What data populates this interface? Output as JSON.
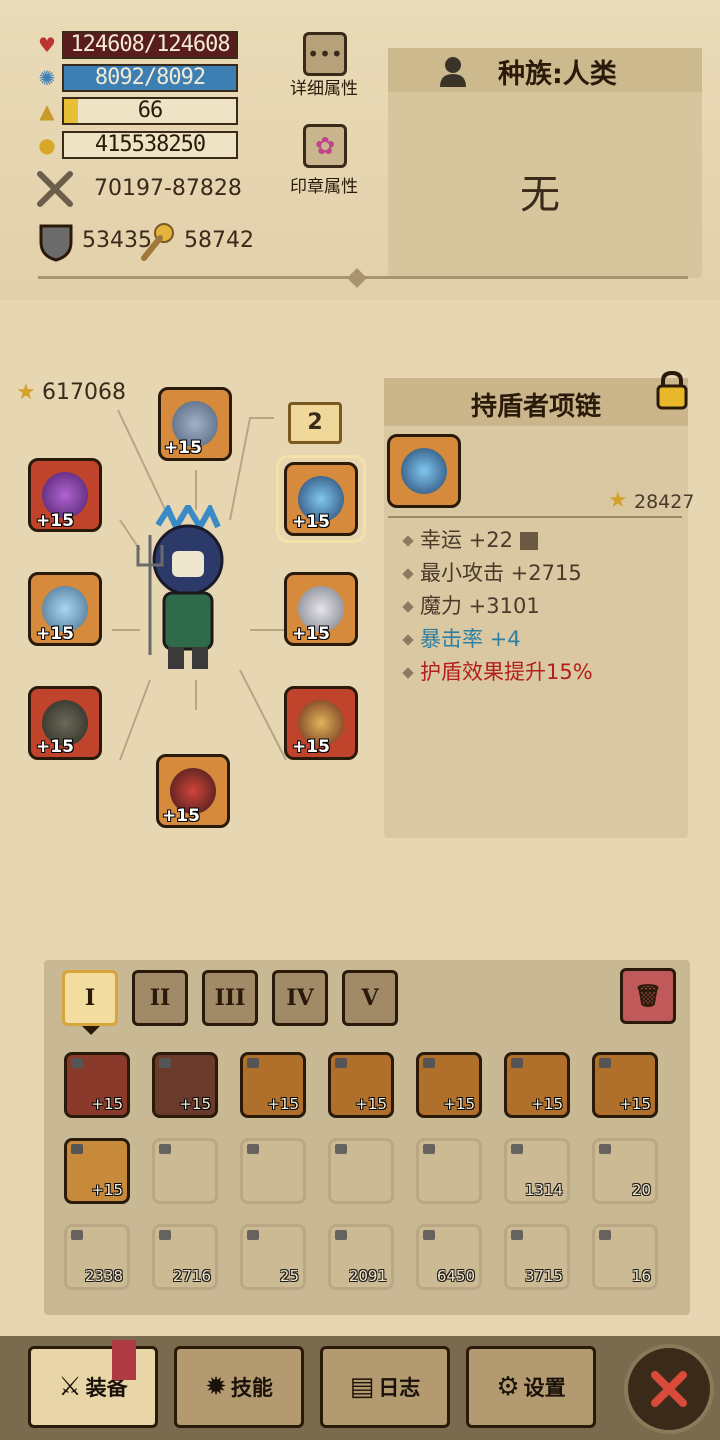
{
  "stats": {
    "hp": "124608/124608",
    "mp": "8092/8092",
    "level": "66",
    "level_progress": 0.08,
    "gold": "415538250",
    "attack": "70197-87828",
    "defense": "53435",
    "magic": "58742"
  },
  "top_buttons": {
    "detail_label": "详细属性",
    "seal_label": "印章属性"
  },
  "race": {
    "label": "种族:人类",
    "value": "无"
  },
  "equipment": {
    "score": "617068",
    "page_badge": "2",
    "plus": "+15"
  },
  "item": {
    "name": "持盾者项链",
    "score": "28427",
    "plus": "+15",
    "attrs": [
      {
        "text": "幸运 +22",
        "color": "#4a3a2a"
      },
      {
        "text": "最小攻击 +2715",
        "color": "#4a3a2a"
      },
      {
        "text": "魔力 +3101",
        "color": "#4a3a2a"
      },
      {
        "text": "暴击率 +4",
        "color": "#2f7fa3"
      },
      {
        "text": "护盾效果提升15%",
        "color": "#b41e1e"
      }
    ]
  },
  "inventory": {
    "tabs": [
      "I",
      "II",
      "III",
      "IV",
      "V"
    ],
    "row1": [
      "+15",
      "+15",
      "+15",
      "+15",
      "+15",
      "+15",
      "+15"
    ],
    "row2_first": "+15",
    "row2_counts": [
      "",
      "",
      "",
      "",
      "1314",
      "20"
    ],
    "row3_counts": [
      "2338",
      "2716",
      "25",
      "2091",
      "6450",
      "3715",
      "16"
    ]
  },
  "nav": {
    "equip": "装备",
    "skill": "技能",
    "log": "日志",
    "settings": "设置"
  },
  "colors": {
    "hp_bar": "#5a1d1d",
    "mp_bar": "#3d7fb3",
    "xp_fill": "#e7bf35",
    "crit_text": "#2f7fa3",
    "special_text": "#b41e1e"
  }
}
